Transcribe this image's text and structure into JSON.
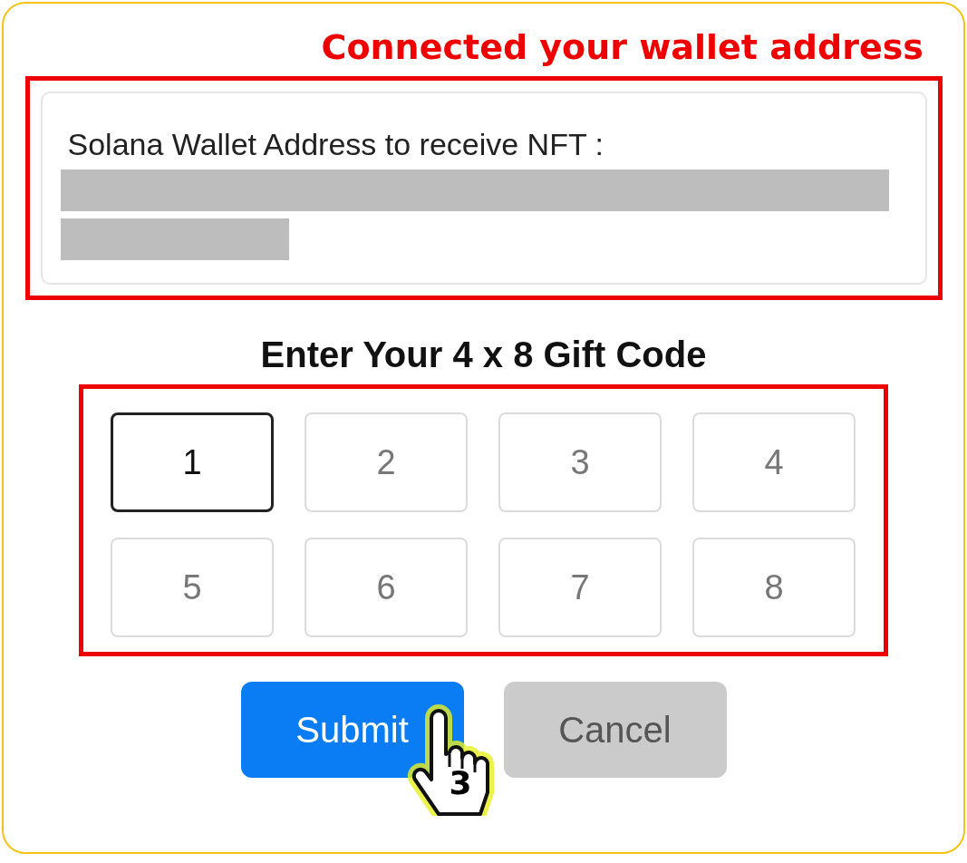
{
  "annotation": {
    "title": "Connected your wallet address"
  },
  "wallet": {
    "label": "Solana Wallet Address to receive NFT :"
  },
  "gift_code": {
    "title": "Enter Your 4 x 8 Gift Code",
    "cells": [
      {
        "value": "1",
        "focused": true
      },
      {
        "placeholder": "2",
        "focused": false
      },
      {
        "placeholder": "3",
        "focused": false
      },
      {
        "placeholder": "4",
        "focused": false
      },
      {
        "placeholder": "5",
        "focused": false
      },
      {
        "placeholder": "6",
        "focused": false
      },
      {
        "placeholder": "7",
        "focused": false
      },
      {
        "placeholder": "8",
        "focused": false
      }
    ]
  },
  "buttons": [
    {
      "label": "Submit",
      "kind": "primary"
    },
    {
      "label": "Cancel",
      "kind": "secondary"
    }
  ],
  "cursor": {
    "step": "3"
  }
}
